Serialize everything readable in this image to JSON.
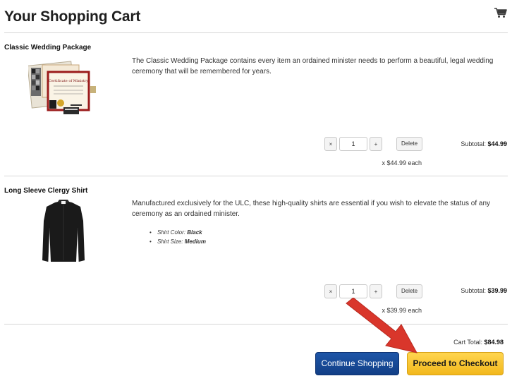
{
  "page": {
    "title": "Your Shopping Cart",
    "cart_icon": "cart-icon"
  },
  "items": [
    {
      "name": "Classic Wedding Package",
      "description": "The Classic Wedding Package contains every item an ordained minister needs to perform a beautiful, legal wedding ceremony that will be remembered for years.",
      "image_icon": "wedding-certificates-image",
      "quantity": "1",
      "minus_label": "×",
      "plus_label": "+",
      "delete_label": "Delete",
      "subtotal_label": "Subtotal:",
      "subtotal_value": "$44.99",
      "each_label": "x $44.99 each"
    },
    {
      "name": "Long Sleeve Clergy Shirt",
      "description": "Manufactured exclusively for the ULC, these high-quality shirts are essential if you wish to elevate the status of any ceremony as an ordained minister.",
      "image_icon": "clergy-shirt-image",
      "options": [
        {
          "label": "Shirt Color:",
          "value": "Black"
        },
        {
          "label": "Shirt Size:",
          "value": "Medium"
        }
      ],
      "quantity": "1",
      "minus_label": "×",
      "plus_label": "+",
      "delete_label": "Delete",
      "subtotal_label": "Subtotal:",
      "subtotal_value": "$39.99",
      "each_label": "x $39.99 each"
    }
  ],
  "totals": {
    "cart_total_label": "Cart Total:",
    "cart_total_value": "$84.98"
  },
  "buttons": {
    "continue_shopping": "Continue Shopping",
    "proceed_checkout": "Proceed to Checkout"
  },
  "colors": {
    "continue_bg": "#1a4f9f",
    "checkout_bg": "#f5c233",
    "arrow": "#d9362b"
  },
  "annotation_icon": "red-arrow-icon"
}
